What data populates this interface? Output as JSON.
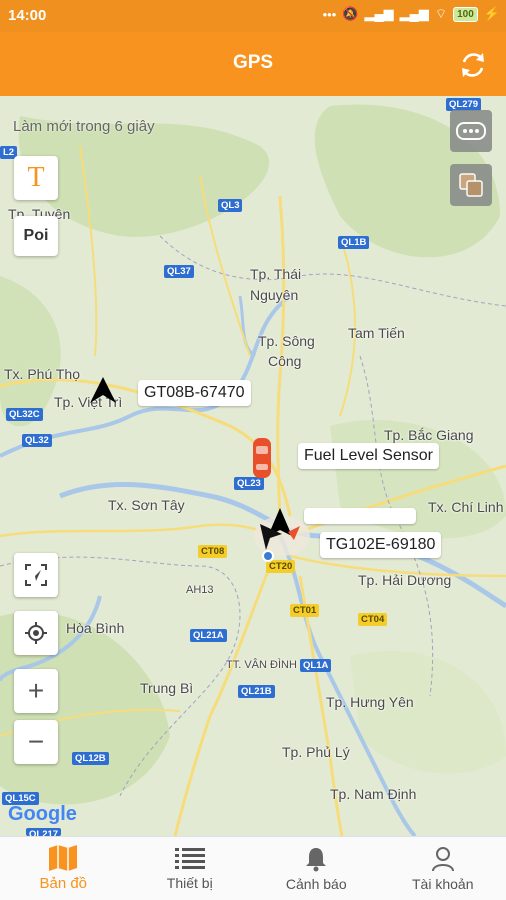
{
  "status_bar": {
    "time": "14:00",
    "battery": "100"
  },
  "header": {
    "title": "GPS"
  },
  "map": {
    "refresh_note": "Làm mới trong 6 giây",
    "poi_label": "Poi",
    "text_button_label": "T",
    "zoom_in": "+",
    "zoom_out": "−",
    "labels": {
      "tuyen": "Tp. Tuyên",
      "thai_nguyen_1": "Tp. Thái",
      "thai_nguyen_2": "Nguyên",
      "song_cong_1": "Tp. Sông",
      "song_cong_2": "Công",
      "tam_tien": "Tam Tiến",
      "phu_tho": "Tx. Phú Thọ",
      "viet_tri": "Tp. Việt Trì",
      "bac_giang": "Tp. Bắc Giang",
      "son_tay": "Tx. Sơn Tây",
      "chi_linh": "Tx. Chí Linh",
      "hai_duong": "Tp. Hải Dương",
      "hoa_binh": "Hòa Bình",
      "trung_bi": "Trung Bì",
      "van_dinh": "TT. VÂN ĐÌNH",
      "hung_yen": "Tp. Hưng Yên",
      "phu_ly": "Tp. Phủ Lý",
      "nam_dinh": "Tp. Nam Định",
      "ah13": "AH13"
    },
    "roads": {
      "ql279": "QL279",
      "ql3": "QL3",
      "ql1b": "QL1B",
      "ql37": "QL37",
      "ql32c": "QL32C",
      "ql32": "QL32",
      "ql23": "QL23",
      "ct08": "CT08",
      "ct20": "CT20",
      "ct01": "CT01",
      "ct04": "CT04",
      "ql21a": "QL21A",
      "ql1a": "QL1A",
      "ql21b": "QL21B",
      "ql12b": "QL12B",
      "ql15c": "QL15C",
      "ql217": "QL217",
      "l2": "L2"
    },
    "vehicles": {
      "v1": "GT08B-67470",
      "v2": "Fuel Level Sensor",
      "v3": "TG102E-69180"
    },
    "google": "Google"
  },
  "bottom_nav": {
    "map": "Bản đồ",
    "devices": "Thiết bị",
    "alerts": "Cảnh báo",
    "account": "Tài khoản"
  },
  "colors": {
    "accent": "#f7931e",
    "status_bar": "#f0901e"
  }
}
